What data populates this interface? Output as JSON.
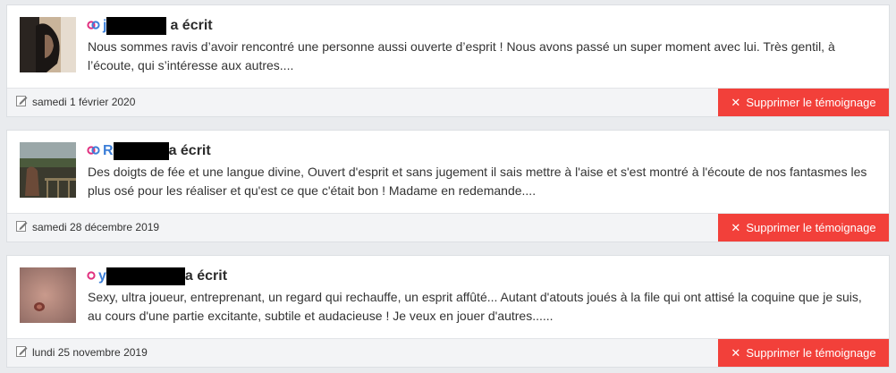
{
  "testimonials": [
    {
      "author_initial": "j",
      "wrote_label": "a écrit",
      "couple_icon": "double-ring-icon",
      "text": "Nous sommes ravis d’avoir rencontré une personne aussi ouverte d’esprit ! Nous avons passé un super moment avec lui. Très gentil, à l’écoute, qui s’intéresse aux autres....",
      "date": "samedi 1 février 2020",
      "delete_label": "Supprimer le témoignage"
    },
    {
      "author_initial": "R",
      "wrote_label": "a écrit",
      "couple_icon": "double-ring-icon",
      "text": "Des doigts de fée et une langue divine, Ouvert d'esprit et sans jugement il sais mettre à l'aise et s'est montré à l'écoute de nos fantasmes les plus osé pour les réaliser et qu'est ce que c'était bon ! Madame en redemande....",
      "date": "samedi 28 décembre 2019",
      "delete_label": "Supprimer le témoignage"
    },
    {
      "author_initial": "y",
      "wrote_label": "a écrit",
      "couple_icon": "single-ring-icon",
      "text": "Sexy, ultra joueur, entreprenant, un regard qui rechauffe, un esprit affûté... Autant d'atouts joués à la file qui ont attisé la coquine que je suis, au cours d'une partie excitante, subtile et audacieuse ! Je veux en jouer d'autres......",
      "date": "lundi 25 novembre 2019",
      "delete_label": "Supprimer le témoignage"
    }
  ],
  "colors": {
    "delete_button": "#f2403a",
    "ring_pink": "#e0307f",
    "ring_blue": "#3d7fd8",
    "footer_bg": "#f3f4f6",
    "page_bg": "#e9ebee"
  }
}
